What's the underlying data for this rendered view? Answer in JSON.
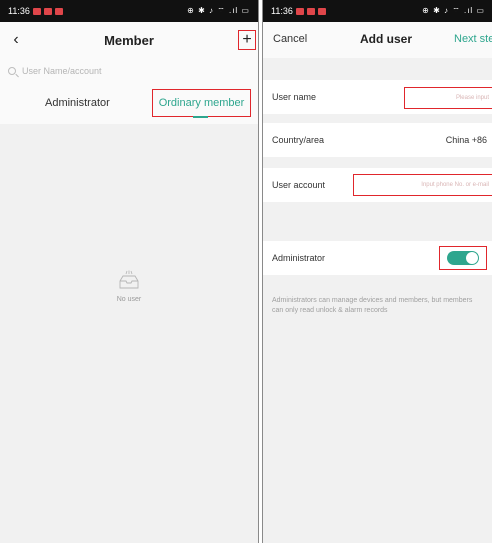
{
  "status_bar": {
    "time": "11:36",
    "indicators": "⊕ ✱ ♪ ⌔ .ıl ▭"
  },
  "member_screen": {
    "title": "Member",
    "back_icon": "chevron-left-icon",
    "add_icon": "plus-icon",
    "search": {
      "placeholder": "User Name/account"
    },
    "tabs": [
      {
        "label": "Administrator",
        "selected": false
      },
      {
        "label": "Ordinary member",
        "selected": true
      }
    ],
    "empty_state": {
      "icon": "empty-inbox-icon",
      "text": "No user"
    }
  },
  "add_user_screen": {
    "cancel_label": "Cancel",
    "title": "Add user",
    "next_label": "Next step",
    "fields": {
      "user_name": {
        "label": "User name",
        "placeholder": "Please input"
      },
      "country": {
        "label": "Country/area",
        "value": "China +86"
      },
      "user_account": {
        "label": "User account",
        "placeholder": "Input phone No. or e-mail"
      },
      "administrator": {
        "label": "Administrator",
        "enabled": true
      }
    },
    "hint": "Administrators can manage devices and members, but members can only read unlock & alarm records"
  },
  "colors": {
    "accent": "#2ea68e",
    "highlight_box": "#e0262c"
  }
}
